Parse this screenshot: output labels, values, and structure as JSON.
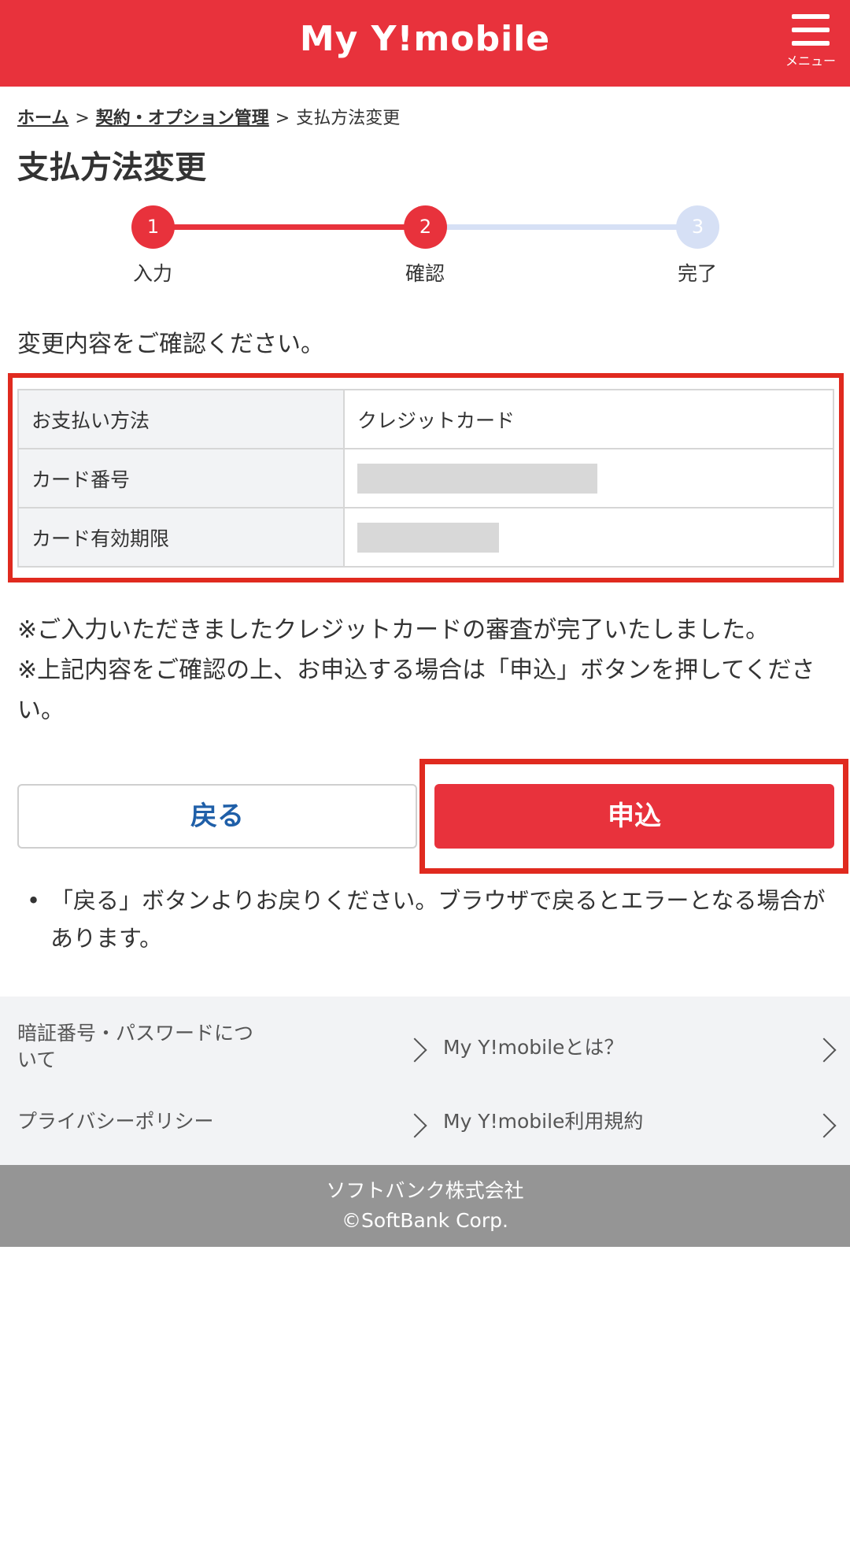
{
  "header": {
    "logo": "My Y!mobile",
    "menu_label": "メニュー"
  },
  "breadcrumb": {
    "home": "ホーム",
    "separator": ">",
    "contract": "契約・オプション管理",
    "current": "支払方法変更"
  },
  "page_title": "支払方法変更",
  "steps": [
    {
      "number": "1",
      "label": "入力",
      "state": "done"
    },
    {
      "number": "2",
      "label": "確認",
      "state": "current"
    },
    {
      "number": "3",
      "label": "完了",
      "state": "pending"
    }
  ],
  "intro": "変更内容をご確認ください。",
  "table": {
    "rows": [
      {
        "label": "お支払い方法",
        "value": "クレジットカード"
      },
      {
        "label": "カード番号",
        "value": ""
      },
      {
        "label": "カード有効期限",
        "value": ""
      }
    ]
  },
  "notes": [
    "※ご入力いただきましたクレジットカードの審査が完了いたしました。",
    "※上記内容をご確認の上、お申込する場合は「申込」ボタンを押してください。"
  ],
  "buttons": {
    "back": "戻る",
    "apply": "申込"
  },
  "caution": {
    "bullet": "•",
    "text": "「戻る」ボタンよりお戻りください。ブラウザで戻るとエラーとなる場合があります。"
  },
  "footer_links": [
    {
      "label": "暗証番号・パスワードについて"
    },
    {
      "label": "My Y!mobileとは？"
    },
    {
      "label": "プライバシーポリシー"
    },
    {
      "label": "My Y!mobile利用規約"
    }
  ],
  "copyright": {
    "company": "ソフトバンク株式会社",
    "corp": "©SoftBank Corp."
  },
  "colors": {
    "brand_red": "#e8323c",
    "highlight_red": "#e02a1f",
    "step_pending": "#d6e0f5",
    "back_text": "#1f5fa8",
    "footer_bg": "#f2f3f5",
    "copyright_bg": "#959595"
  }
}
